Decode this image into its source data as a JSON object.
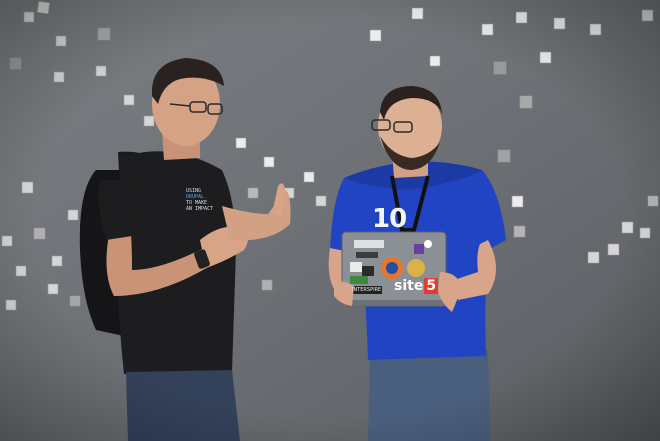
{
  "scene": {
    "description_colors": {
      "wall": "#6f7377",
      "cube": "#d9d9d9",
      "blue_shirt": "#1f3fb8",
      "black_shirt": "#1d1d1f",
      "jeans": "#34435a",
      "laptop": "#8d9298"
    },
    "shirt_text": [
      "Using",
      "Drupal",
      "to make",
      "an impact"
    ],
    "shirt_number": "10",
    "laptop_stickers": {
      "site_word": "site",
      "site_box": "5",
      "small_label": "INTERSPIRE"
    }
  }
}
